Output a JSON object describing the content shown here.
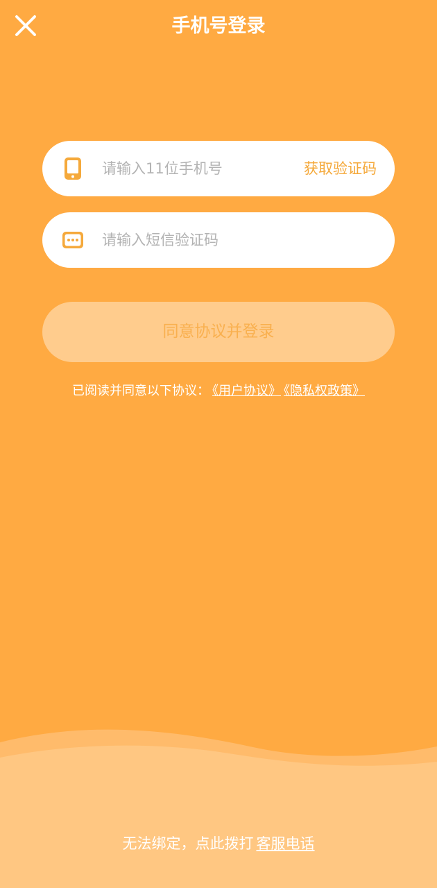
{
  "header": {
    "title": "手机号登录",
    "close_icon": "close-icon"
  },
  "form": {
    "phone": {
      "icon": "phone-icon",
      "placeholder": "请输入11位手机号",
      "value": "",
      "get_code_label": "获取验证码"
    },
    "sms_code": {
      "icon": "message-icon",
      "placeholder": "请输入短信验证码",
      "value": ""
    },
    "submit_label": "同意协议并登录"
  },
  "agreement": {
    "prefix": "已阅读并同意以下协议：",
    "user_agreement": "《用户协议》",
    "privacy_policy": "《隐私权政策》"
  },
  "support": {
    "prefix": "无法绑定，点此拨打",
    "link": "客服电话"
  },
  "colors": {
    "background": "#FFAA42",
    "accent": "#F5A93B",
    "button_disabled_bg": "#FFCC8D",
    "wave": "#FFC782"
  }
}
